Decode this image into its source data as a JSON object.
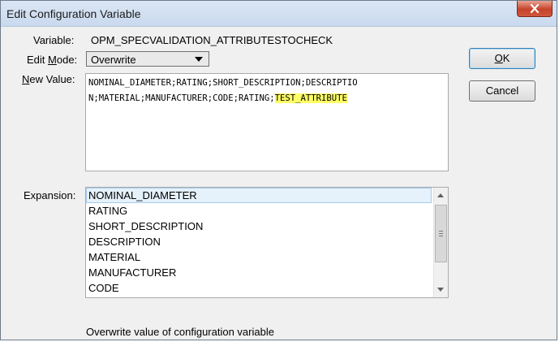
{
  "window": {
    "title": "Edit Configuration Variable"
  },
  "form": {
    "variable_label": "Variable:",
    "variable_value": "OPM_SPECVALIDATION_ATTRIBUTESTOCHECK",
    "edit_mode_label_pre": "Edit ",
    "edit_mode_label_key": "M",
    "edit_mode_label_post": "ode:",
    "edit_mode_value": "Overwrite",
    "new_value_label_key": "N",
    "new_value_label_post": "ew Value:",
    "new_value_line1": "NOMINAL_DIAMETER;RATING;SHORT_DESCRIPTION;DESCRIPTIO",
    "new_value_line2_plain": "N;MATERIAL;MANUFACTURER;CODE;RATING;",
    "new_value_line2_highlight": "TEST_ATTRIBUTE",
    "expansion_label": "Expansion:"
  },
  "expansion_list": [
    "NOMINAL_DIAMETER",
    "RATING",
    "SHORT_DESCRIPTION",
    "DESCRIPTION",
    "MATERIAL",
    "MANUFACTURER",
    "CODE"
  ],
  "buttons": {
    "ok_key": "O",
    "ok_post": "K",
    "cancel": "Cancel"
  },
  "status_text": "Overwrite value of configuration variable",
  "icons": {
    "close": "close-icon",
    "dropdown": "chevron-down-icon",
    "scroll_up": "arrow-up-icon",
    "scroll_down": "arrow-down-icon"
  },
  "colors": {
    "highlight": "#ffff66",
    "title_bar": "#c9d9ee",
    "close_button": "#c7432b"
  }
}
